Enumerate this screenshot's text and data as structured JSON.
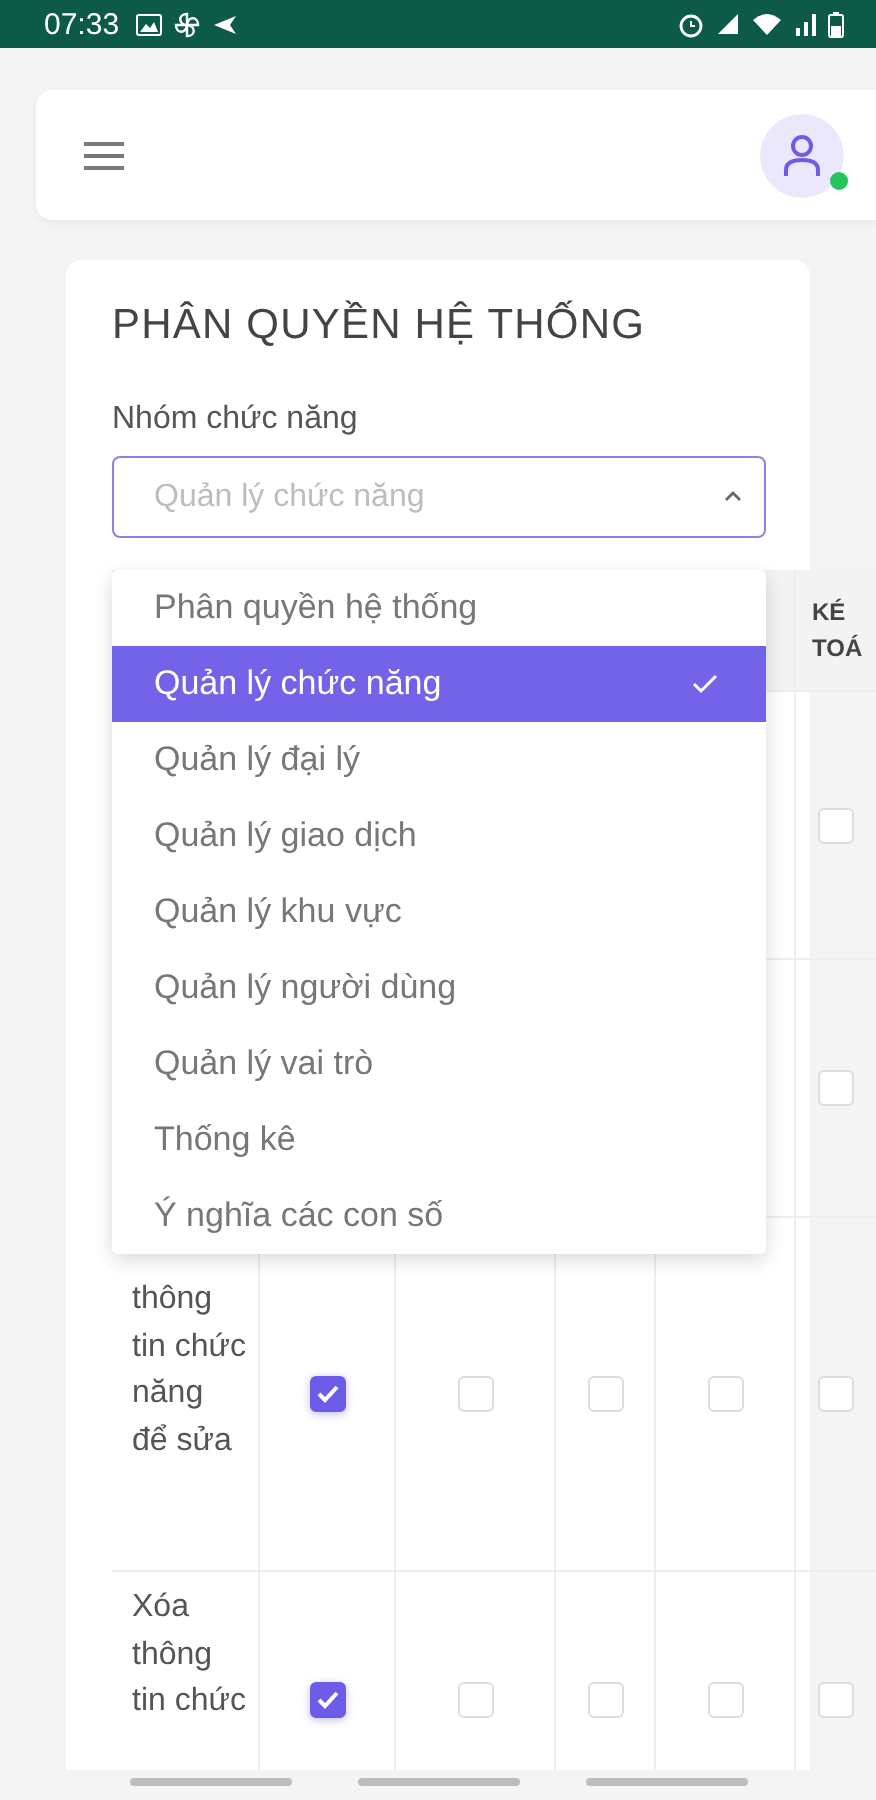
{
  "status_bar": {
    "time": "07:33"
  },
  "page": {
    "title": "PHÂN QUYỀN HỆ THỐNG",
    "group_label": "Nhóm chức năng",
    "group_select": {
      "placeholder": "Quản lý chức năng",
      "expanded": true
    }
  },
  "dropdown_options": [
    {
      "label": "Phân quyền hệ thống",
      "selected": false
    },
    {
      "label": "Quản lý chức năng",
      "selected": true
    },
    {
      "label": "Quản lý đại lý",
      "selected": false
    },
    {
      "label": "Quản lý giao dịch",
      "selected": false
    },
    {
      "label": "Quản lý khu vực",
      "selected": false
    },
    {
      "label": "Quản lý người dùng",
      "selected": false
    },
    {
      "label": "Quản lý vai trò",
      "selected": false
    },
    {
      "label": "Thống kê",
      "selected": false
    },
    {
      "label": "Ý nghĩa các con số",
      "selected": false
    }
  ],
  "table": {
    "column_6_header": "KÉ TOÁ",
    "rows": [
      {
        "cells": [
          null,
          null,
          null,
          null,
          {
            "checked": false
          }
        ]
      },
      {
        "cells": [
          null,
          null,
          null,
          null,
          {
            "checked": false
          }
        ]
      },
      {
        "name": "thông tin chức năng để sửa",
        "cells": [
          {
            "checked": true
          },
          {
            "checked": false
          },
          {
            "checked": false
          },
          {
            "checked": false
          },
          {
            "checked": false
          }
        ]
      },
      {
        "name": "Xóa thông tin chức",
        "cells": [
          {
            "checked": true
          },
          {
            "checked": false
          },
          {
            "checked": false
          },
          {
            "checked": false
          },
          {
            "checked": false
          }
        ]
      }
    ]
  }
}
